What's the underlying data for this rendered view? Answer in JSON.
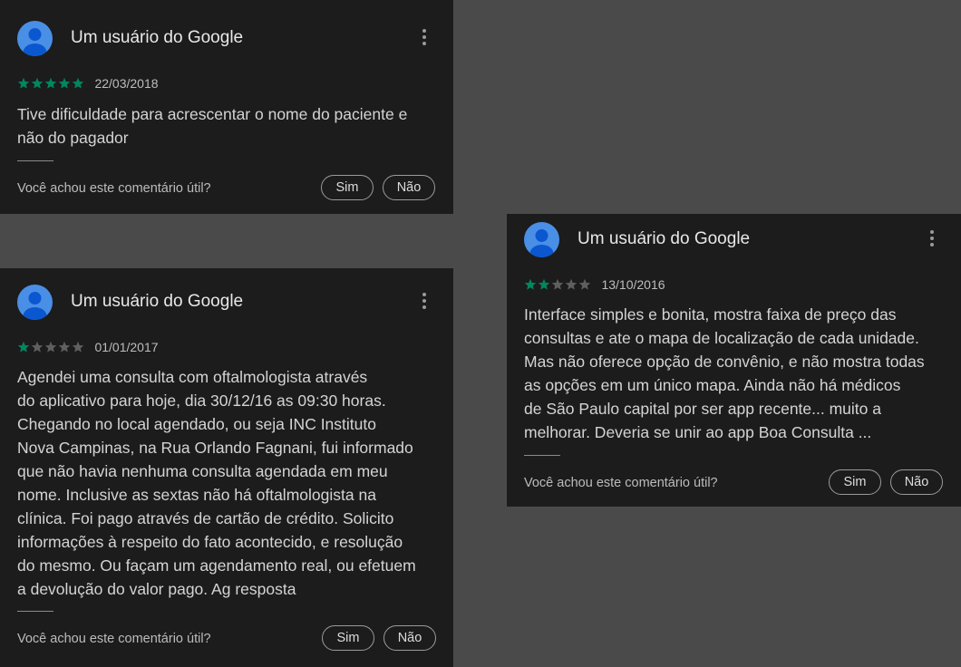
{
  "colors": {
    "background": "#4a4a4a",
    "card": "#1c1c1c",
    "star_filled": "#01875f",
    "star_empty": "#5f5f5f",
    "avatar": "#4a8fe6"
  },
  "reviews": [
    {
      "author": "Um usuário do Google",
      "rating": 5,
      "max_rating": 5,
      "date": "22/03/2018",
      "text_lines": [
        "Tive dificuldade para acrescentar o nome do paciente e",
        "não do pagador"
      ],
      "helpful_question": "Você achou este comentário útil?",
      "yes_label": "Sim",
      "no_label": "Não"
    },
    {
      "author": "Um usuário do Google",
      "rating": 1,
      "max_rating": 5,
      "date": "01/01/2017",
      "text_lines": [
        "Agendei uma consulta com oftalmologista através",
        "do aplicativo para hoje, dia 30/12/16 as 09:30 horas.",
        "Chegando no local agendado, ou seja INC Instituto",
        "Nova Campinas, na Rua Orlando Fagnani, fui informado",
        "que não havia nenhuma consulta agendada em meu",
        "nome. Inclusive as sextas não há oftalmologista na",
        "clínica. Foi pago através de cartão de crédito.  Solicito",
        "informações à respeito do fato acontecido, e resolução",
        "do mesmo.  Ou façam um agendamento real, ou efetuem",
        "a  devolução do valor pago. Ag resposta"
      ],
      "helpful_question": "Você achou este comentário útil?",
      "yes_label": "Sim",
      "no_label": "Não"
    },
    {
      "author": "Um usuário do Google",
      "rating": 2,
      "max_rating": 5,
      "date": "13/10/2016",
      "text_lines": [
        "Interface simples e bonita, mostra faixa de preço das",
        "consultas e ate o mapa de localização de cada unidade.",
        "Mas não oferece opção de convênio, e não mostra todas",
        "as opções em um único mapa. Ainda não há médicos",
        "de São Paulo capital por ser app recente... muito a",
        "melhorar. Deveria se unir ao app Boa Consulta ..."
      ],
      "helpful_question": "Você achou este comentário útil?",
      "yes_label": "Sim",
      "no_label": "Não"
    }
  ]
}
